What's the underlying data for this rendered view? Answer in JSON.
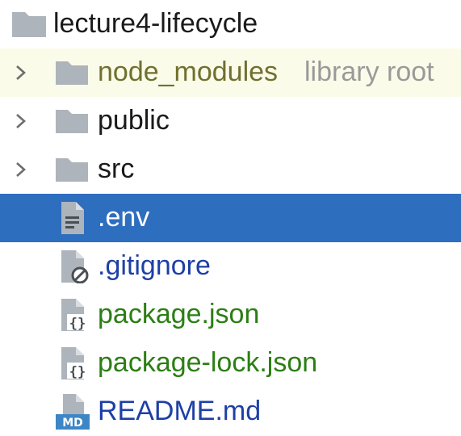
{
  "project": {
    "name": "lecture4-lifecycle",
    "icon": "folder-icon"
  },
  "items": [
    {
      "name": "node_modules",
      "hint": "library root",
      "type": "folder",
      "expandable": true,
      "state": "excluded",
      "icon": "folder-icon"
    },
    {
      "name": "public",
      "type": "folder",
      "expandable": true,
      "icon": "folder-icon"
    },
    {
      "name": "src",
      "type": "folder",
      "expandable": true,
      "icon": "folder-icon"
    },
    {
      "name": ".env",
      "type": "file",
      "selected": true,
      "icon": "text-file-icon"
    },
    {
      "name": ".gitignore",
      "type": "file",
      "icon": "ignore-file-icon"
    },
    {
      "name": "package.json",
      "type": "file",
      "icon": "json-file-icon"
    },
    {
      "name": "package-lock.json",
      "type": "file",
      "icon": "json-file-icon"
    },
    {
      "name": "README.md",
      "type": "file",
      "icon": "markdown-file-icon"
    }
  ],
  "colors": {
    "selection": "#2e6ebf",
    "excluded_background": "#fbfbe9",
    "folder_icon": "#aeb4bb",
    "git_new_file": "#2c7e14",
    "git_modified": "#1d3fa6",
    "library_text": "#707030",
    "hint_text": "#9a9a9a"
  }
}
